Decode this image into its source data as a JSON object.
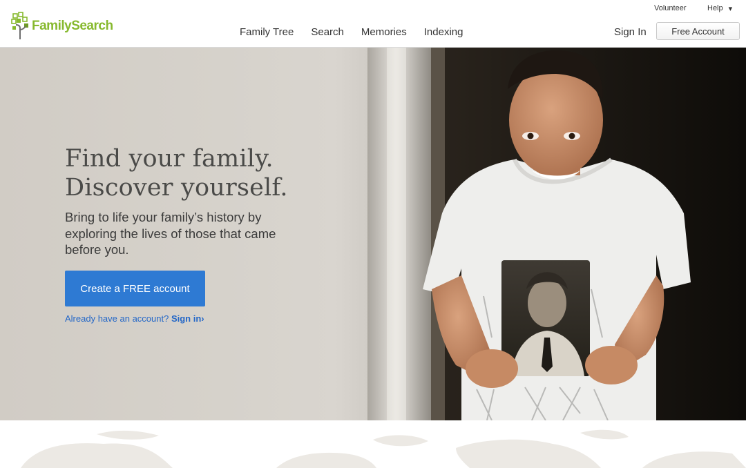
{
  "brand": {
    "name": "FamilySearch",
    "accent": "#87b92e"
  },
  "utility_nav": {
    "volunteer": "Volunteer",
    "help": "Help",
    "help_caret": "▾"
  },
  "main_nav": {
    "items": [
      "Family Tree",
      "Search",
      "Memories",
      "Indexing"
    ]
  },
  "account": {
    "sign_in": "Sign In",
    "free_account": "Free Account"
  },
  "hero": {
    "headline_1": "Find your family.",
    "headline_2": "Discover yourself.",
    "subhead": "Bring to life your family’s history by exploring the lives of those that came before you.",
    "cta": "Create a FREE account",
    "cta_color": "#2e7ad3",
    "already_text": "Already have an account?",
    "sign_in_link": "Sign in",
    "link_arrow": "›"
  },
  "icons": [
    "family-tree-logo-icon",
    "chevron-down-icon",
    "chevron-right-icon"
  ]
}
